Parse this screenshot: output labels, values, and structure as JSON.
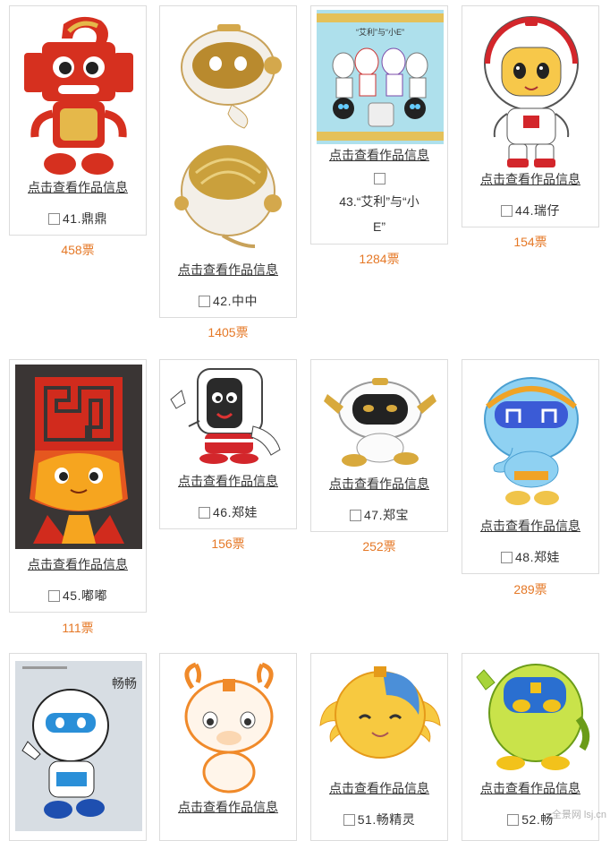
{
  "link_label": "点击查看作品信息",
  "entries": [
    {
      "name": "41.鼎鼎",
      "votes": "458票",
      "icon": "ding-mascot-image"
    },
    {
      "name": "42.中中",
      "votes": "1405票",
      "icon": "white-robot-mascot-image"
    },
    {
      "name_line1": "43.“艾利”与“小",
      "name_line2": "E”",
      "image_caption": "“艾利”与“小E”",
      "votes": "1284票",
      "icon": "group-mascot-image"
    },
    {
      "name": "44.瑞仔",
      "votes": "154票",
      "icon": "astronaut-mascot-image"
    },
    {
      "name": "45.嘟嘟",
      "votes": "111票",
      "icon": "red-bronze-mascot-image"
    },
    {
      "name": "46.郑娃",
      "votes": "156票",
      "icon": "phone-robot-mascot-image"
    },
    {
      "name": "47.郑宝",
      "votes": "252票",
      "icon": "black-white-robot-mascot-image"
    },
    {
      "name": "48.郑娃",
      "votes": "289票",
      "icon": "blue-elephant-mascot-image"
    },
    {
      "name": "",
      "image_caption": "畅畅",
      "icon": "blue-helmet-mascot-image"
    },
    {
      "name": "",
      "icon": "orange-deer-mascot-image"
    },
    {
      "name": "51.畅精灵",
      "icon": "yellow-wing-mascot-image"
    },
    {
      "name": "52.畅",
      "icon": "green-robot-mascot-image"
    }
  ],
  "watermark": "全景网 lsj.cn",
  "colors": {
    "votes": "#e57826",
    "border": "#dcdcdc"
  }
}
